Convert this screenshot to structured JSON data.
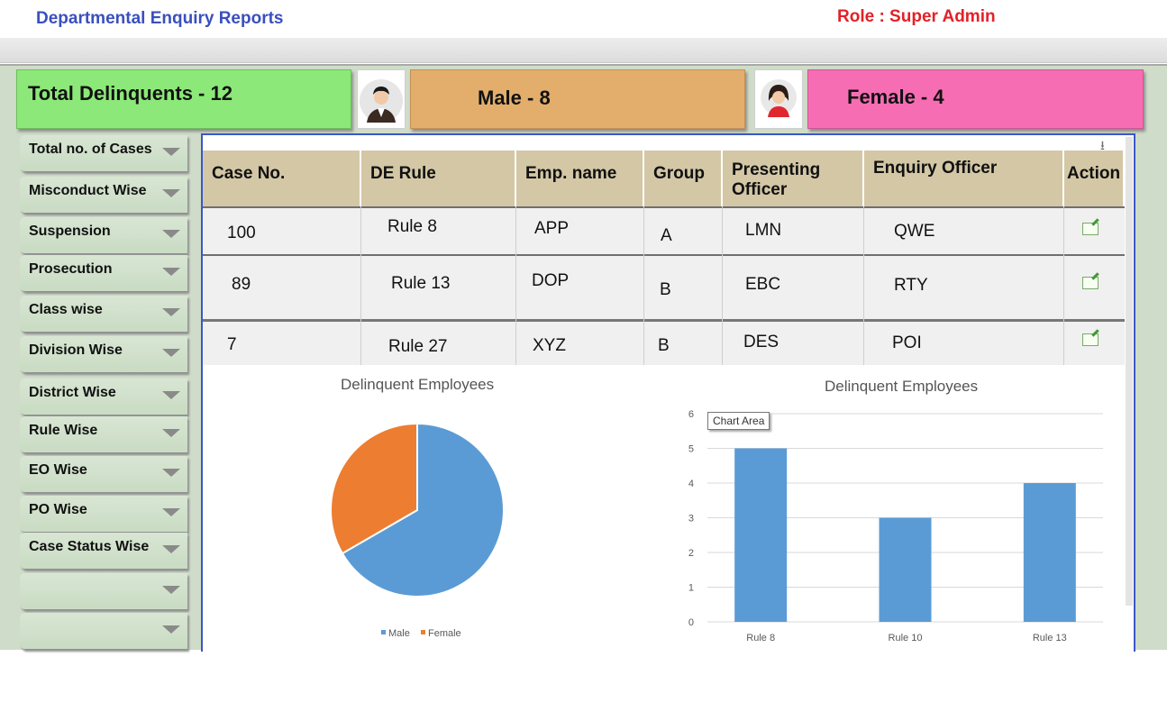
{
  "header": {
    "app_title": "Departmental Enquiry Reports",
    "role": "Role : Super Admin"
  },
  "summary": {
    "total": "Total Delinquents - 12",
    "male": "Male - 8",
    "female": "Female - 4",
    "male_avatar_icon": "male-user-icon",
    "female_avatar_icon": "female-user-icon",
    "colors": {
      "total": "#8ce878",
      "male": "#e3ae6c",
      "female": "#f76db3"
    }
  },
  "sidebar": {
    "items": [
      {
        "label": "Total no. of Cases"
      },
      {
        "label": "Misconduct Wise"
      },
      {
        "label": "Suspension"
      },
      {
        "label": "Prosecution"
      },
      {
        "label": "Class wise"
      },
      {
        "label": "Division Wise"
      },
      {
        "label": "District Wise"
      },
      {
        "label": "Rule Wise"
      },
      {
        "label": "EO Wise"
      },
      {
        "label": "PO Wise"
      },
      {
        "label": "Case Status Wise"
      },
      {
        "label": ""
      },
      {
        "label": ""
      }
    ]
  },
  "table": {
    "columns": [
      "Case No.",
      "DE Rule",
      "Emp. name",
      "Group",
      "Presenting Officer",
      "Enquiry Officer",
      "Action"
    ],
    "rows": [
      {
        "case_no": "100",
        "rule": "Rule 8",
        "emp": "APP",
        "group": "A",
        "po": "LMN",
        "eo": "QWE",
        "action_icon": "edit-icon"
      },
      {
        "case_no": "89",
        "rule": "Rule 13",
        "emp": "DOP",
        "group": "B",
        "po": "EBC",
        "eo": "RTY",
        "action_icon": "edit-icon"
      },
      {
        "case_no": "7",
        "rule": "Rule 27",
        "emp": "XYZ",
        "group": "B",
        "po": "DES",
        "eo": "POI",
        "action_icon": "edit-icon"
      }
    ]
  },
  "charts": {
    "pie_title": "Delinquent Employees",
    "bar_title": "Delinquent Employees",
    "bar_tooltip": "Chart Area"
  },
  "chart_data": [
    {
      "type": "pie",
      "title": "Delinquent Employees",
      "categories": [
        "Male",
        "Female"
      ],
      "values": [
        8,
        4
      ],
      "colors": [
        "#5b9bd5",
        "#ed7d31"
      ],
      "legend": "bottom"
    },
    {
      "type": "bar",
      "title": "Delinquent Employees",
      "categories": [
        "Rule 8",
        "Rule 10",
        "Rule 13"
      ],
      "values": [
        5,
        3,
        4
      ],
      "ylim": [
        0,
        6
      ],
      "yticks": [
        "0",
        "1",
        "2",
        "3",
        "4",
        "5",
        "6"
      ],
      "color": "#5b9bd5",
      "grid": true
    }
  ]
}
